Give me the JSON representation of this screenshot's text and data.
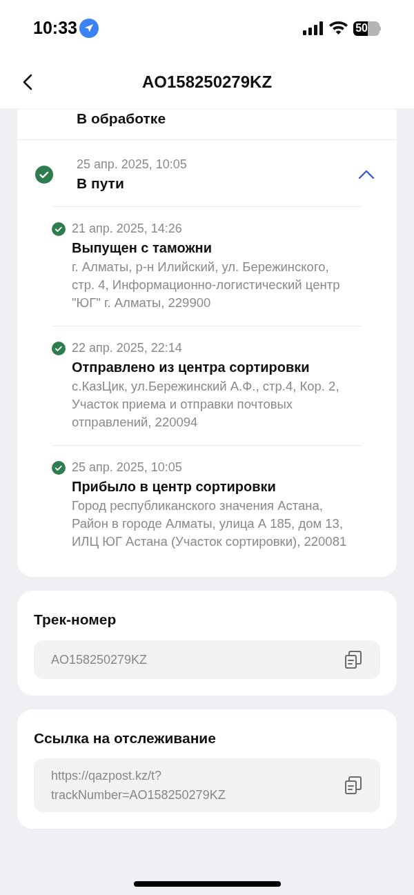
{
  "status_bar": {
    "time": "10:33",
    "battery": "50"
  },
  "header": {
    "title": "AO158250279KZ"
  },
  "previous_status": {
    "title": "В обработке"
  },
  "current_status": {
    "date": "25 апр. 2025, 10:05",
    "title": "В пути",
    "expanded": true,
    "events": [
      {
        "date": "21 апр. 2025, 14:26",
        "title": "Выпущен с таможни",
        "address": "г. Алматы, р-н Илийский, ул. Бережинского, стр. 4, Информационно-логистический центр \"ЮГ\" г. Алматы, 229900"
      },
      {
        "date": "22 апр. 2025, 22:14",
        "title": "Отправлено из центра сортировки",
        "address": "с.КазЦик, ул.Бережинский А.Ф., стр.4, Кор. 2, Участок приема и отправки почтовых отправлений, 220094"
      },
      {
        "date": "25 апр. 2025, 10:05",
        "title": "Прибыло в центр сортировки",
        "address": "Город республиканского значения Астана, Район в городе Алматы, улица А 185, дом 13, ИЛЦ ЮГ Астана (Участок сортировки), 220081"
      }
    ]
  },
  "fields": [
    {
      "label": "Трек-номер",
      "value": "AO158250279KZ"
    },
    {
      "label": "Ссылка на отслеживание",
      "value": "https://qazpost.kz/t?\ntrackNumber=AO158250279KZ"
    }
  ]
}
